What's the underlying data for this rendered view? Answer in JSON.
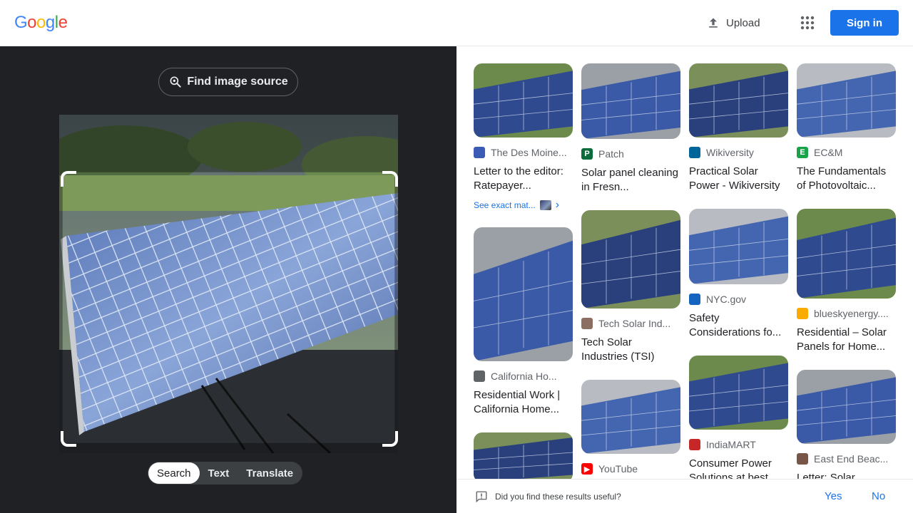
{
  "header": {
    "logo_letters": [
      "G",
      "o",
      "o",
      "g",
      "l",
      "e"
    ],
    "logo_colors": [
      "#4285f4",
      "#ea4335",
      "#fbbc05",
      "#4285f4",
      "#34a853",
      "#ea4335"
    ],
    "upload_label": "Upload",
    "signin_label": "Sign in"
  },
  "left": {
    "find_source_label": "Find image source",
    "modes": [
      "Search",
      "Text",
      "Translate"
    ],
    "active_mode": "Search"
  },
  "results": {
    "columns": [
      [
        {
          "source": "The Des Moine...",
          "title": "Letter to the editor: Ratepayer...",
          "fav_color": "#3b5bb5",
          "fav_text": "",
          "thumb_h": 104,
          "exact_label": "See exact mat..."
        },
        {
          "source": "California Ho...",
          "title": "Residential Work | California Home...",
          "fav_color": "#5f6368",
          "fav_text": "",
          "thumb_h": 188
        },
        {
          "source": "",
          "title": "",
          "fav_color": "",
          "fav_text": "",
          "thumb_h": 70
        }
      ],
      [
        {
          "source": "Patch",
          "title": "Solar panel cleaning in Fresn...",
          "fav_color": "#0b6b3a",
          "fav_text": "P",
          "thumb_h": 106
        },
        {
          "source": "Tech Solar Ind...",
          "title": "Tech Solar Industries (TSI)",
          "fav_color": "#8d6e63",
          "fav_text": "",
          "thumb_h": 138
        },
        {
          "source": "YouTube",
          "title": "",
          "fav_color": "#ff0000",
          "fav_text": "▶",
          "thumb_h": 104
        }
      ],
      [
        {
          "source": "Wikiversity",
          "title": "Practical Solar Power - Wikiversity",
          "fav_color": "#006699",
          "fav_text": "",
          "thumb_h": 104
        },
        {
          "source": "NYC.gov",
          "title": "Safety Considerations fo...",
          "fav_color": "#1565c0",
          "fav_text": "",
          "thumb_h": 106
        },
        {
          "source": "IndiaMART",
          "title": "Consumer Power Solutions at best...",
          "fav_color": "#c62828",
          "fav_text": "",
          "thumb_h": 104
        }
      ],
      [
        {
          "source": "EC&M",
          "title": "The Fundamentals of Photovoltaic...",
          "fav_color": "#17a34a",
          "fav_text": "E",
          "thumb_h": 104
        },
        {
          "source": "blueskyenergy....",
          "title": "Residential – Solar Panels for Home...",
          "fav_color": "#f9ab00",
          "fav_text": "",
          "thumb_h": 126
        },
        {
          "source": "East End Beac...",
          "title": "Letter: Solar",
          "fav_color": "#795548",
          "fav_text": "",
          "thumb_h": 104
        }
      ]
    ]
  },
  "feedback": {
    "question": "Did you find these results useful?",
    "yes_label": "Yes",
    "no_label": "No"
  }
}
